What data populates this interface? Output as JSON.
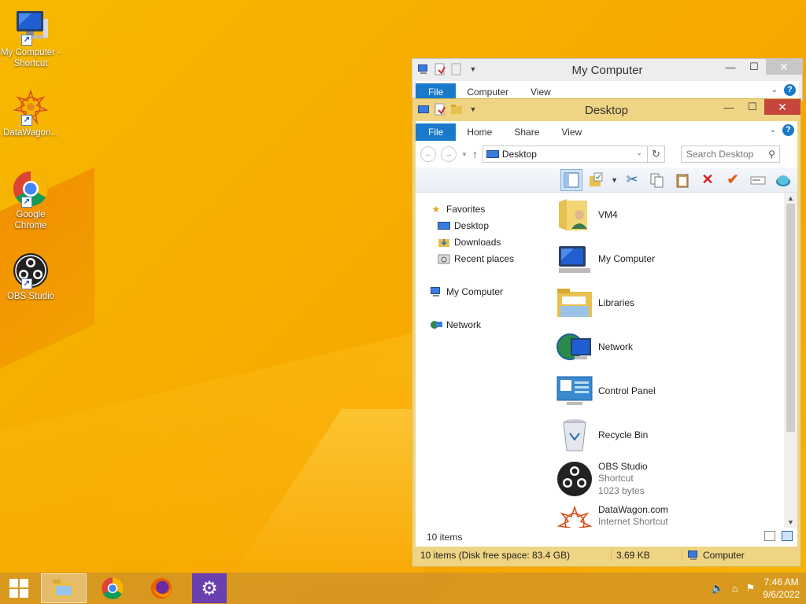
{
  "desktop": {
    "icons": [
      {
        "label": "My Computer - Shortcut",
        "icon": "computer-icon"
      },
      {
        "label": "DataWagon...",
        "icon": "datawagon-icon"
      },
      {
        "label": "Google Chrome",
        "icon": "chrome-icon"
      },
      {
        "label": "OBS Studio",
        "icon": "obs-icon"
      }
    ]
  },
  "back_window": {
    "title": "My Computer",
    "tabs": [
      "File",
      "Computer",
      "View"
    ]
  },
  "front_window": {
    "title": "Desktop",
    "tabs": [
      "File",
      "Home",
      "Share",
      "View"
    ],
    "address": "Desktop",
    "search_placeholder": "Search Desktop",
    "nav": {
      "favorites": "Favorites",
      "favorites_items": [
        "Desktop",
        "Downloads",
        "Recent places"
      ],
      "my_computer": "My Computer",
      "network": "Network"
    },
    "files": [
      {
        "name": "VM4",
        "icon": "user-folder-icon"
      },
      {
        "name": "My Computer",
        "icon": "computer-icon"
      },
      {
        "name": "Libraries",
        "icon": "libraries-icon"
      },
      {
        "name": "Network",
        "icon": "network-icon"
      },
      {
        "name": "Control Panel",
        "icon": "control-panel-icon"
      },
      {
        "name": "Recycle Bin",
        "icon": "recycle-bin-icon"
      },
      {
        "name": "OBS Studio",
        "sub1": "Shortcut",
        "sub2": "1023 bytes",
        "icon": "obs-icon"
      },
      {
        "name": "DataWagon.com",
        "sub1": "Internet Shortcut",
        "icon": "datawagon-icon"
      }
    ],
    "item_count": "10 items",
    "status": {
      "left": "10 items (Disk free space: 83.4 GB)",
      "size": "3.69 KB",
      "location": "Computer"
    }
  },
  "taskbar": {
    "time": "7:46 AM",
    "date": "9/6/2022"
  },
  "colors": {
    "accent": "#1979ca",
    "close": "#c7463c",
    "frame": "#efd483"
  }
}
